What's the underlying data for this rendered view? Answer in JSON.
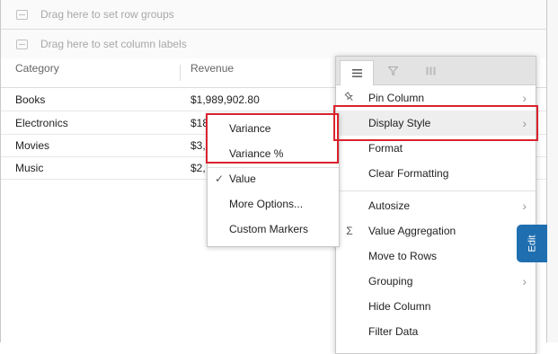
{
  "drop_zones": {
    "row_groups": "Drag here to set row groups",
    "column_labels": "Drag here to set column labels"
  },
  "columns": {
    "category": "Category",
    "revenue": "Revenue"
  },
  "rows": [
    {
      "category": "Books",
      "revenue": "$1,989,902.80"
    },
    {
      "category": "Electronics",
      "revenue": "$18"
    },
    {
      "category": "Movies",
      "revenue": "$3,"
    },
    {
      "category": "Music",
      "revenue": "$2,"
    }
  ],
  "column_menu": {
    "tabs": [
      "general-menu-icon",
      "filter-icon",
      "columns-icon"
    ],
    "items": {
      "pin_column": "Pin Column",
      "display_style": "Display Style",
      "format": "Format",
      "clear_formatting": "Clear Formatting",
      "autosize": "Autosize",
      "value_aggregation": "Value Aggregation",
      "move_to_rows": "Move to Rows",
      "grouping": "Grouping",
      "hide_column": "Hide Column",
      "filter_data": "Filter Data"
    },
    "sigma": "Σ",
    "chevron": "›"
  },
  "display_style_submenu": {
    "items": {
      "variance": "Variance",
      "variance_pct": "Variance %",
      "value": "Value",
      "more_options": "More Options...",
      "custom_markers": "Custom Markers"
    },
    "checked": "value",
    "check_glyph": "✓"
  },
  "edit_tab": "Edit",
  "highlight_color": "#d9232e",
  "edit_tab_color": "#1f6fb0"
}
